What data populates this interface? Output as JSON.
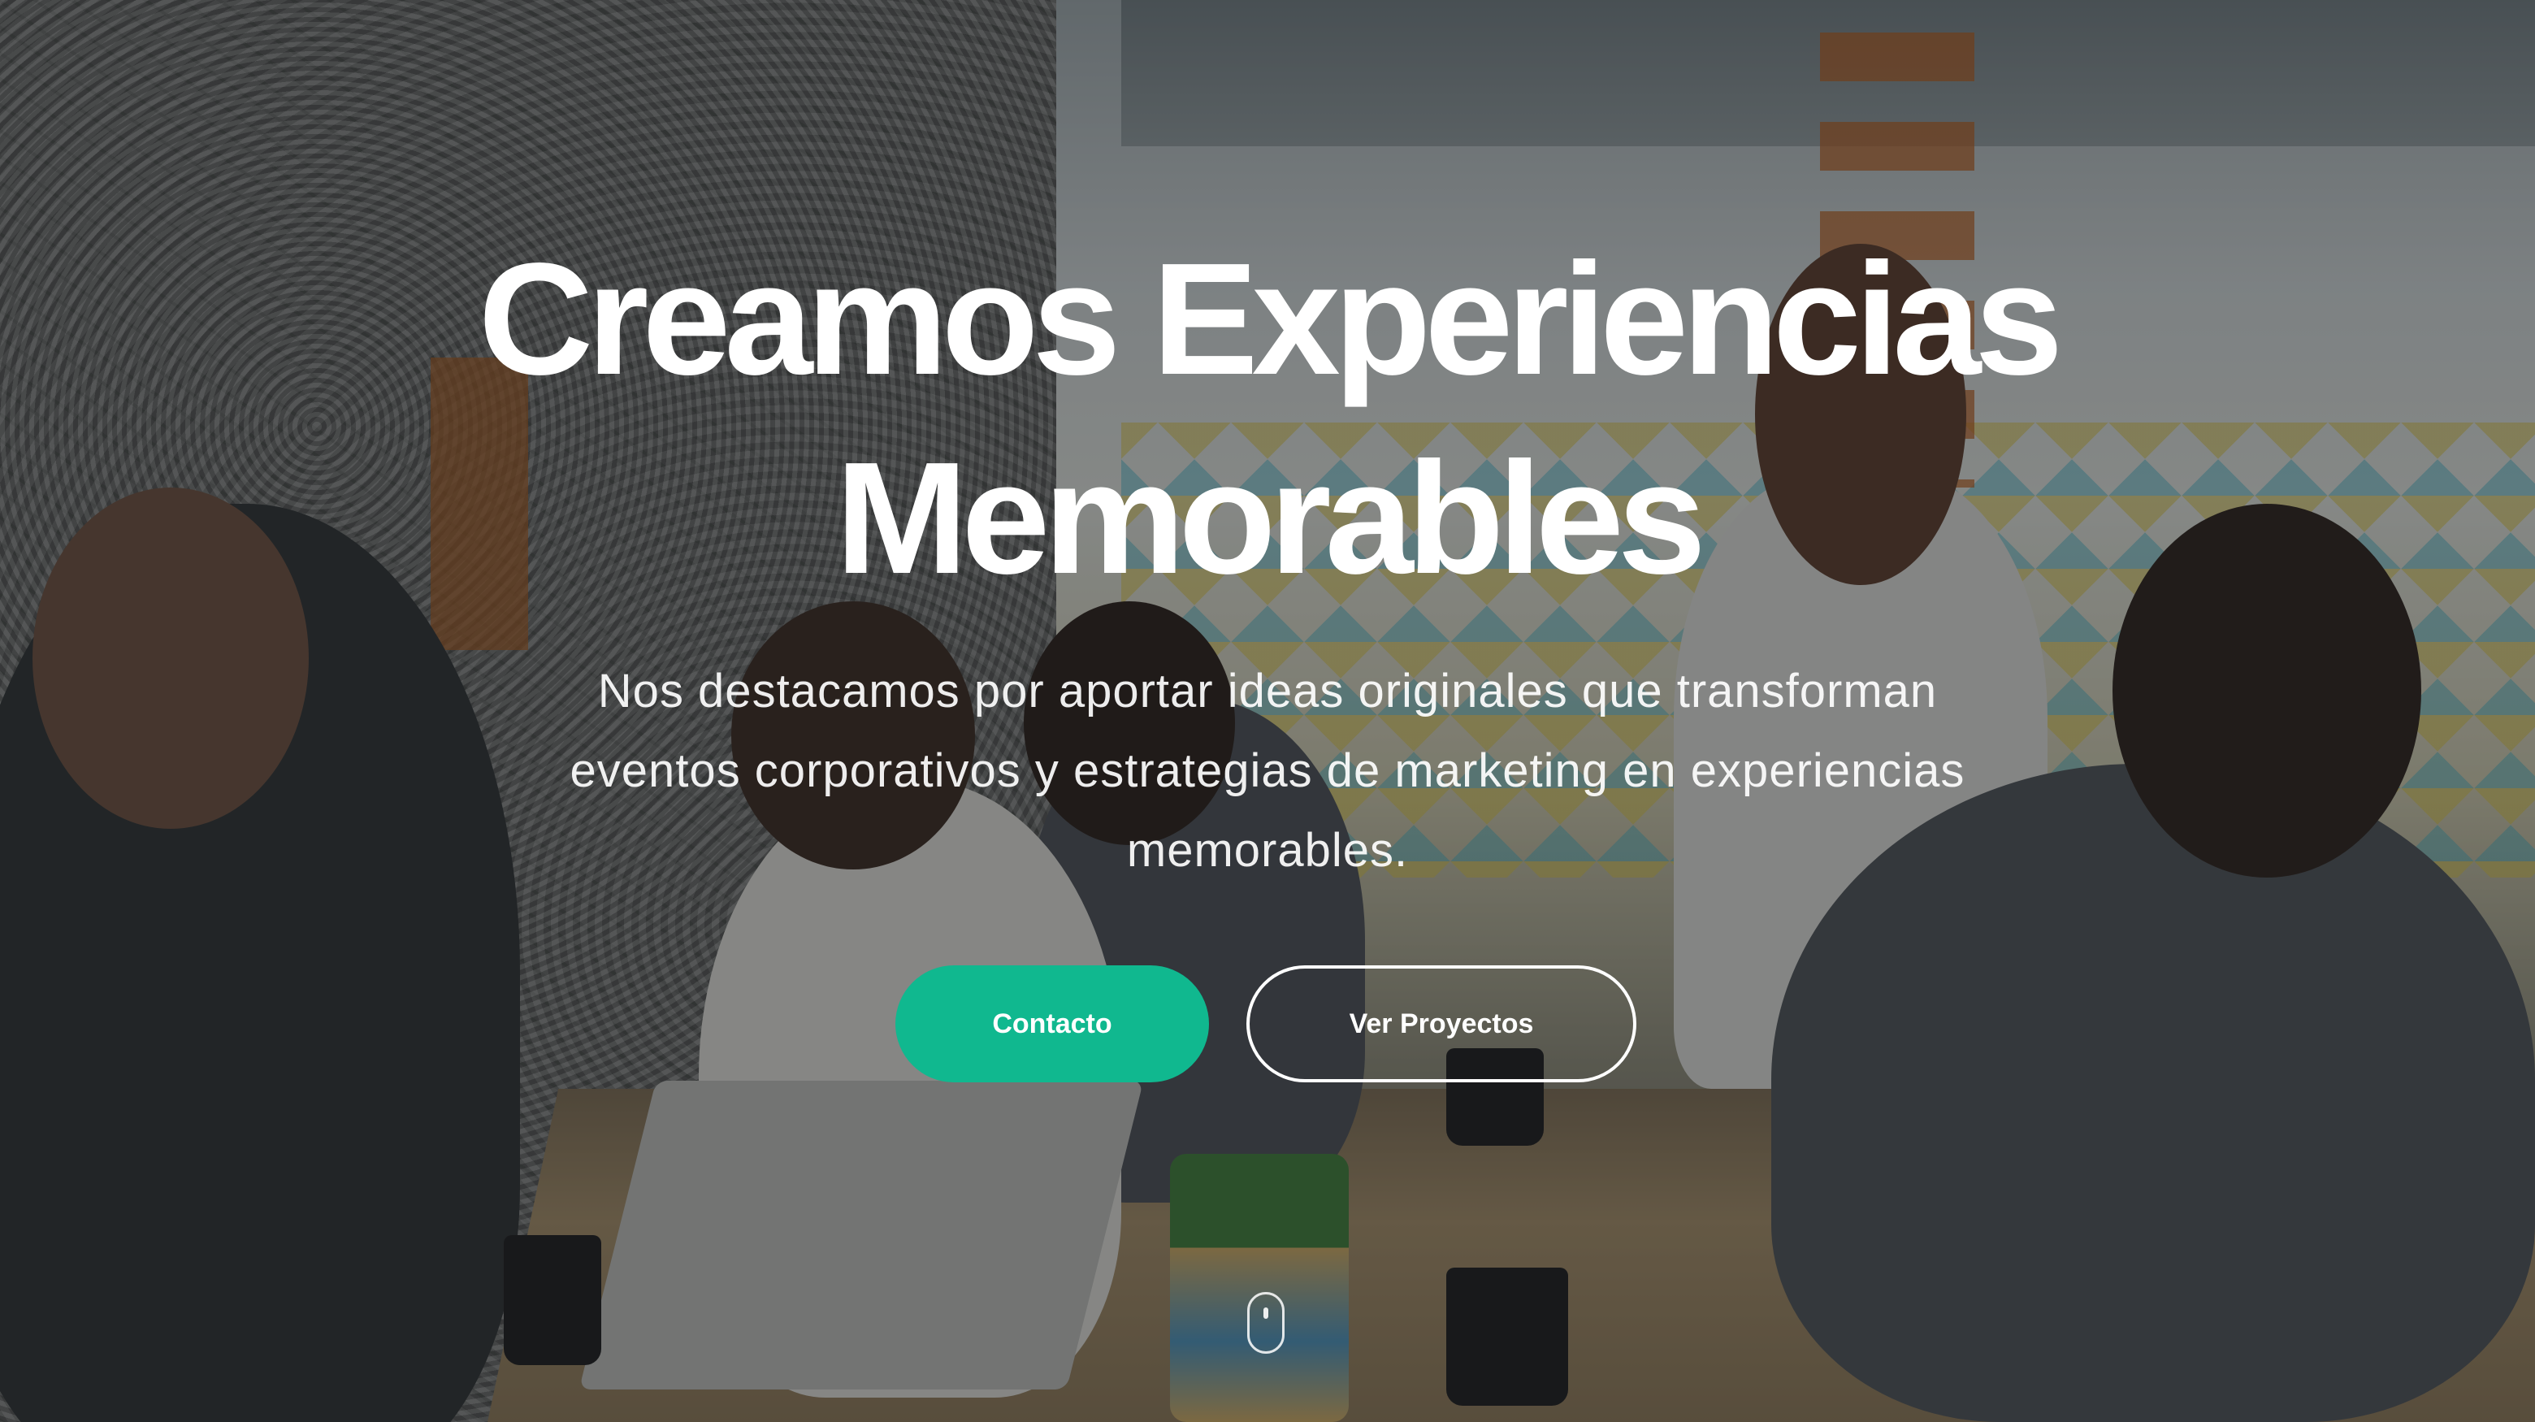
{
  "hero": {
    "headline_line1": "Creamos Experiencias",
    "headline_line2": "Memorables",
    "subtitle": "Nos destacamos por aportar ideas originales que transforman eventos corporativos y estrategias de marketing en experiencias memorables.",
    "buttons": {
      "primary_label": "Contacto",
      "secondary_label": "Ver Proyectos"
    }
  },
  "colors": {
    "accent": "#10b88f",
    "text": "#ffffff",
    "overlay": "rgba(20,22,24,0.42)"
  },
  "icons": {
    "scroll": "mouse-scroll-icon"
  }
}
